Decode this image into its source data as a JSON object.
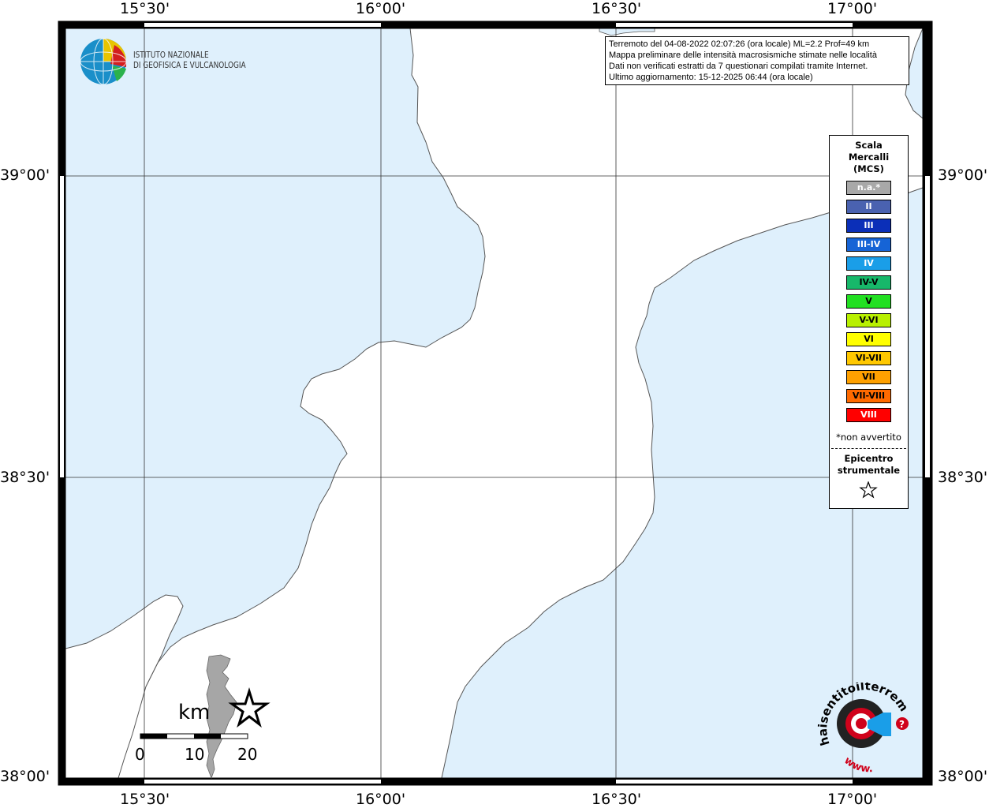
{
  "info": {
    "line1": "Terremoto del 04-08-2022 02:07:26 (ora locale) ML=2.2 Prof=49 km",
    "line2": "Mappa preliminare delle intensità macrosismiche stimate nelle località",
    "line3": "Dati non verificati estratti da 7 questionari compilati tramite Internet.",
    "line4": "Ultimo aggiornamento: 15-12-2025 06:44 (ora locale)"
  },
  "logo": {
    "line1": "ISTITUTO NAZIONALE",
    "line2": "DI GEOFISICA E VULCANOLOGIA"
  },
  "axes": {
    "top": [
      "15°30'",
      "16°00'",
      "16°30'",
      "17°00'"
    ],
    "bottom": [
      "15°30'",
      "16°00'",
      "16°30'",
      "17°00'"
    ],
    "left": [
      "39°00'",
      "38°30'",
      "38°00'"
    ],
    "right": [
      "39°00'",
      "38°30'",
      "38°00'"
    ]
  },
  "legend": {
    "title_line1": "Scala",
    "title_line2": "Mercalli",
    "title_line3": "(MCS)",
    "items": [
      {
        "label": "n.a.*",
        "color": "#a8a8a8",
        "text_color": "#ffffff"
      },
      {
        "label": "II",
        "color": "#4a62b0",
        "text_color": "#ffffff"
      },
      {
        "label": "III",
        "color": "#0b2fb8",
        "text_color": "#ffffff"
      },
      {
        "label": "III-IV",
        "color": "#1664d6",
        "text_color": "#ffffff"
      },
      {
        "label": "IV",
        "color": "#1a9ee8",
        "text_color": "#ffffff"
      },
      {
        "label": "IV-V",
        "color": "#17b86a",
        "text_color": "#000000"
      },
      {
        "label": "V",
        "color": "#22e022",
        "text_color": "#000000"
      },
      {
        "label": "V-VI",
        "color": "#b8f000",
        "text_color": "#000000"
      },
      {
        "label": "VI",
        "color": "#ffff00",
        "text_color": "#000000"
      },
      {
        "label": "VI-VII",
        "color": "#ffc800",
        "text_color": "#000000"
      },
      {
        "label": "VII",
        "color": "#ffa000",
        "text_color": "#000000"
      },
      {
        "label": "VII-VIII",
        "color": "#ff6a00",
        "text_color": "#000000"
      },
      {
        "label": "VIII",
        "color": "#ff0000",
        "text_color": "#ffffff"
      }
    ],
    "note": "*non avvertito",
    "epicenter_line1": "Epicentro",
    "epicenter_line2": "strumentale"
  },
  "scale_bar": {
    "unit": "km",
    "labels": [
      "0",
      "10",
      "20"
    ]
  },
  "colors": {
    "sea": "#dff0fc",
    "land": "#ffffff",
    "coast": "#555555",
    "inset_land": "#a6a6a6"
  },
  "haisentito": {
    "text": "haisentitoilterremoto.it",
    "www": "www."
  }
}
